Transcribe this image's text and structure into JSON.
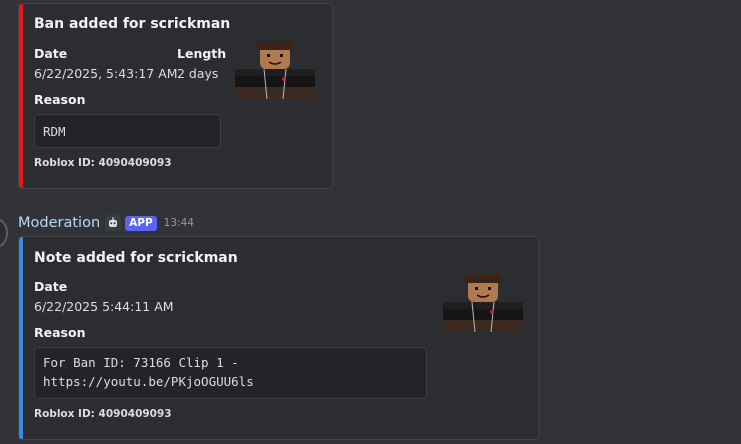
{
  "ban_embed": {
    "title": "Ban added for scrickman",
    "accent_color": "#e8181a",
    "fields": {
      "date_label": "Date",
      "date_value": "6/22/2025, 5:43:17 AM",
      "length_label": "Length",
      "length_value": "2 days",
      "reason_label": "Reason",
      "reason_value": "RDM"
    },
    "footer": "Roblox ID: 4090409093",
    "thumbnail": "roblox-avatar-headshot"
  },
  "message": {
    "username": "Moderation",
    "bot_icon": "robot-icon",
    "badge": "APP",
    "timestamp": "13:44"
  },
  "note_embed": {
    "title": "Note added for scrickman",
    "accent_color": "#3b8bdf",
    "fields": {
      "date_label": "Date",
      "date_value": "6/22/2025 5:44:11 AM",
      "reason_label": "Reason",
      "reason_line1": "For Ban ID: 73166 Clip 1 -",
      "reason_line2": "https://youtu.be/PKjoOGUU6ls"
    },
    "footer": "Roblox ID: 4090409093",
    "thumbnail": "roblox-avatar-headshot"
  }
}
